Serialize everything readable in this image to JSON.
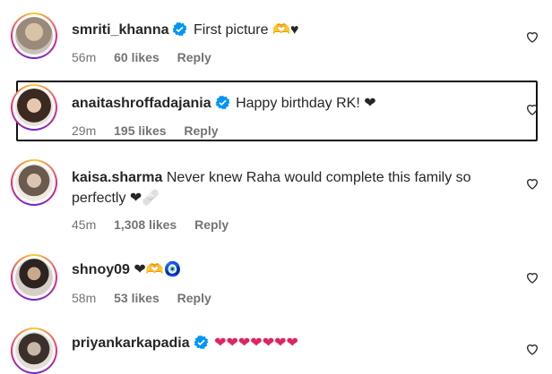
{
  "comments": [
    {
      "user": "smriti_khanna",
      "verified": true,
      "text": "First picture 🫶♥",
      "time": "56m",
      "likes": "60 likes",
      "reply": "Reply"
    },
    {
      "user": "anaitashroffadajania",
      "verified": true,
      "text": "Happy birthday RK! ❤",
      "time": "29m",
      "likes": "195 likes",
      "reply": "Reply"
    },
    {
      "user": "kaisa.sharma",
      "verified": false,
      "text": "Never knew Raha would complete this family so",
      "text2": "perfectly ❤🩹",
      "time": "45m",
      "likes": "1,308 likes",
      "reply": "Reply"
    },
    {
      "user": "shnoy09",
      "verified": false,
      "text": "❤🫶🧿",
      "time": "58m",
      "likes": "53 likes",
      "reply": "Reply"
    },
    {
      "user": "priyankarkapadia",
      "verified": true,
      "text": "❤❤❤❤❤❤❤"
    }
  ],
  "colors": {
    "heart": "#e0245e",
    "verified": "#0095f6",
    "meta": "#737373"
  }
}
